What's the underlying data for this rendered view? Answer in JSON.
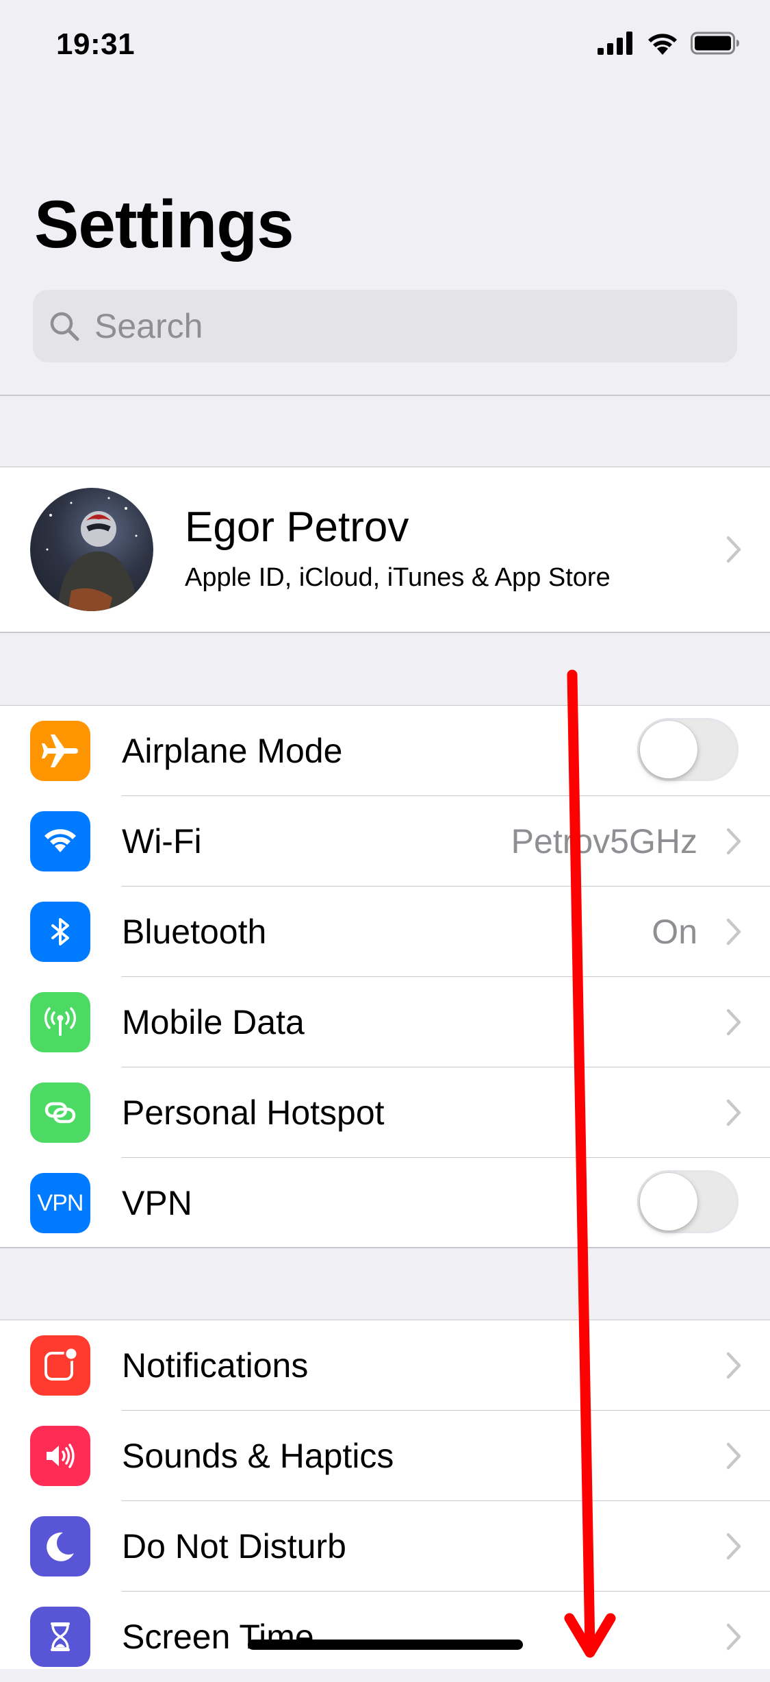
{
  "status_bar": {
    "time": "19:31"
  },
  "header": {
    "title": "Settings"
  },
  "search": {
    "placeholder": "Search"
  },
  "profile": {
    "name": "Egor Petrov",
    "subtitle": "Apple ID, iCloud, iTunes & App Store"
  },
  "connectivity": [
    {
      "label": "Airplane Mode",
      "icon": "airplane-icon",
      "color": "#ff9500",
      "toggle": false
    },
    {
      "label": "Wi-Fi",
      "icon": "wifi-icon",
      "color": "#007aff",
      "value": "Petrov5GHz"
    },
    {
      "label": "Bluetooth",
      "icon": "bluetooth-icon",
      "color": "#007aff",
      "value": "On"
    },
    {
      "label": "Mobile Data",
      "icon": "antenna-icon",
      "color": "#4cd964"
    },
    {
      "label": "Personal Hotspot",
      "icon": "hotspot-icon",
      "color": "#4cd964"
    },
    {
      "label": "VPN",
      "icon": "vpn-icon",
      "icon_text": "VPN",
      "color": "#007aff",
      "toggle": false
    }
  ],
  "system": [
    {
      "label": "Notifications",
      "icon": "notifications-icon",
      "color": "#ff3b30"
    },
    {
      "label": "Sounds & Haptics",
      "icon": "speaker-icon",
      "color": "#ff2d55"
    },
    {
      "label": "Do Not Disturb",
      "icon": "moon-icon",
      "color": "#5856d6"
    },
    {
      "label": "Screen Time",
      "icon": "hourglass-icon",
      "color": "#5856d6"
    }
  ],
  "annotation_arrow_color": "#ff0000"
}
